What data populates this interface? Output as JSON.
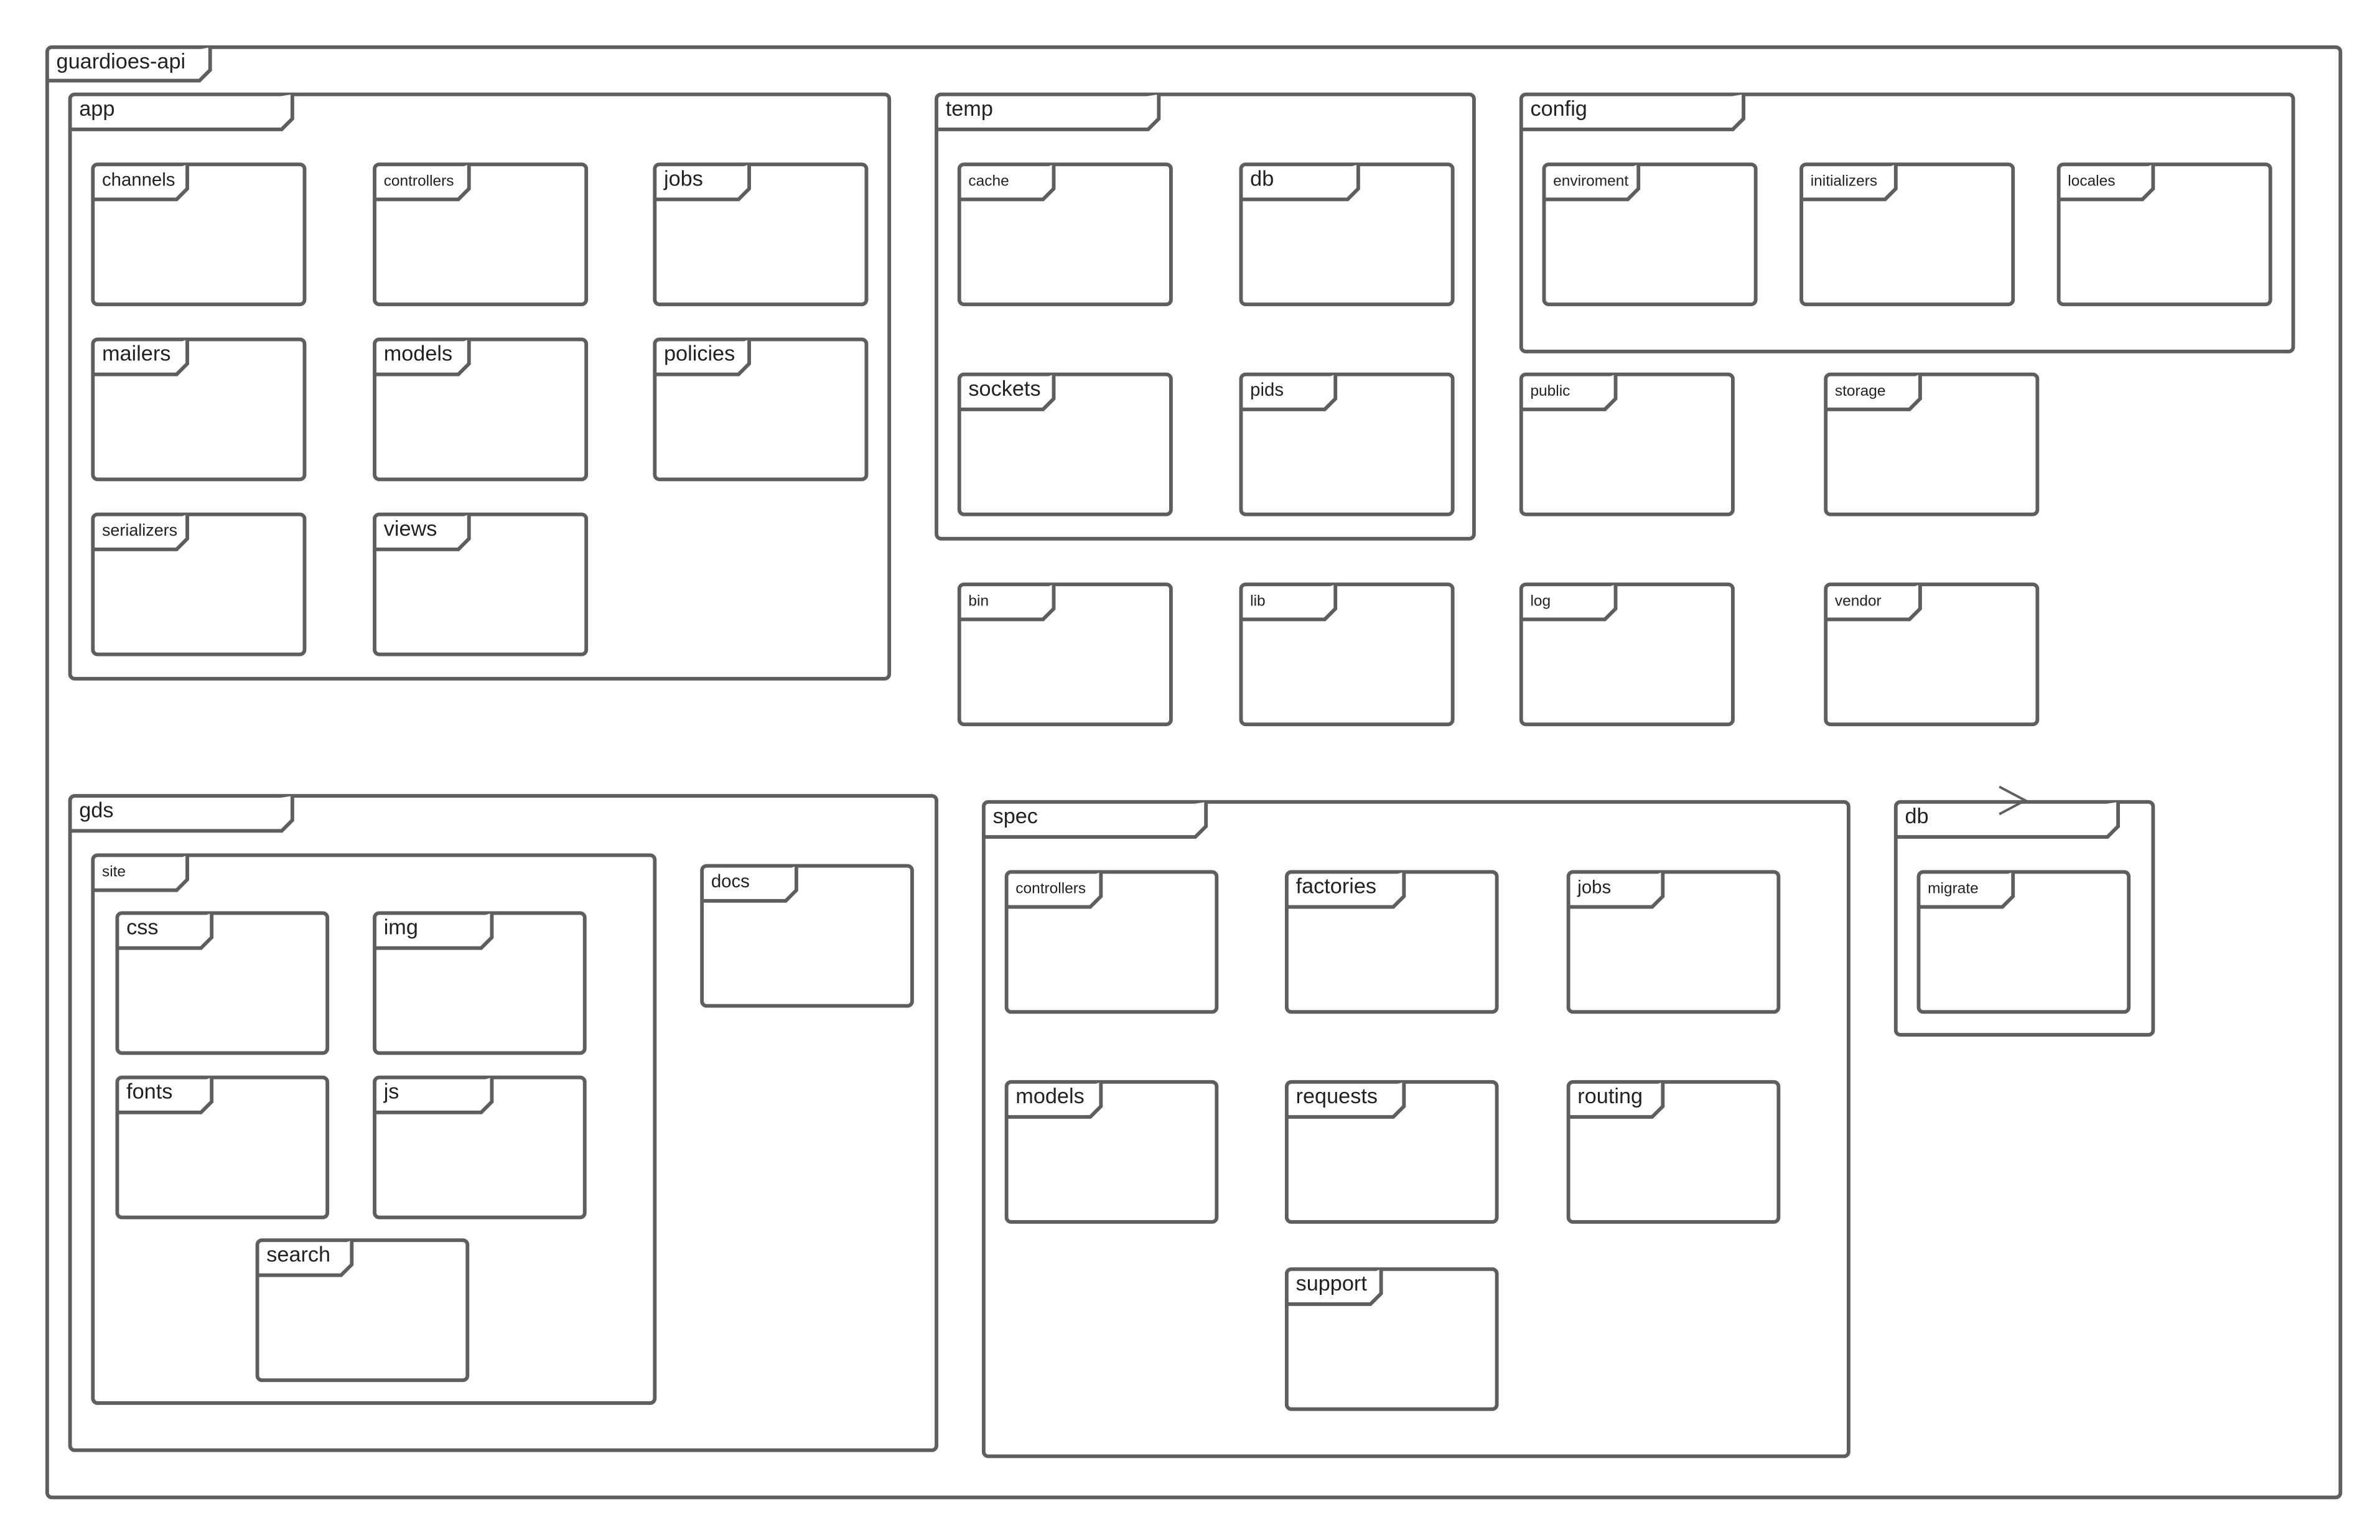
{
  "diagram": {
    "type": "uml-package-diagram",
    "stroke_color": "#5e5e5e",
    "text_color": "#222222",
    "background": "#ffffff",
    "root": {
      "label": "guardioes-api",
      "children": [
        {
          "label": "app",
          "children": [
            {
              "label": "channels"
            },
            {
              "label": "controllers"
            },
            {
              "label": "jobs"
            },
            {
              "label": "mailers"
            },
            {
              "label": "models"
            },
            {
              "label": "policies"
            },
            {
              "label": "serializers"
            },
            {
              "label": "views"
            }
          ]
        },
        {
          "label": "temp",
          "children": [
            {
              "label": "cache"
            },
            {
              "label": "db"
            },
            {
              "label": "sockets"
            },
            {
              "label": "pids"
            }
          ]
        },
        {
          "label": "config",
          "children": [
            {
              "label": "enviroment"
            },
            {
              "label": "initializers"
            },
            {
              "label": "locales"
            }
          ]
        },
        {
          "label": "public"
        },
        {
          "label": "storage"
        },
        {
          "label": "bin"
        },
        {
          "label": "lib"
        },
        {
          "label": "log"
        },
        {
          "label": "vendor"
        },
        {
          "label": "gds",
          "children": [
            {
              "label": "site",
              "children": [
                {
                  "label": "css"
                },
                {
                  "label": "img"
                },
                {
                  "label": "fonts"
                },
                {
                  "label": "js"
                },
                {
                  "label": "search"
                }
              ]
            },
            {
              "label": "docs"
            }
          ]
        },
        {
          "label": "spec",
          "children": [
            {
              "label": "controllers"
            },
            {
              "label": "factories"
            },
            {
              "label": "jobs"
            },
            {
              "label": "models"
            },
            {
              "label": "requests"
            },
            {
              "label": "routing"
            },
            {
              "label": "support"
            }
          ]
        },
        {
          "label": "db",
          "children": [
            {
              "label": "migrate"
            }
          ]
        }
      ]
    }
  }
}
